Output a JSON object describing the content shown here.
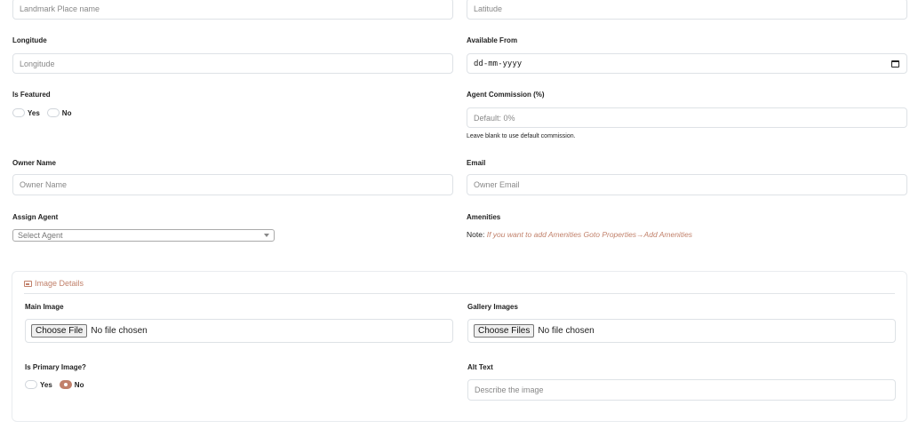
{
  "fields": {
    "landmark": {
      "placeholder": "Landmark Place name"
    },
    "latitude": {
      "placeholder": "Latitude"
    },
    "longitude": {
      "label": "Longitude",
      "placeholder": "Longitude"
    },
    "available_from": {
      "label": "Available From",
      "value": "dd-mm-yyyy",
      "icon": "calendar-icon"
    },
    "is_featured": {
      "label": "Is Featured",
      "options": [
        "Yes",
        "No"
      ],
      "selected": null
    },
    "agent_commission": {
      "label": "Agent Commission (%)",
      "placeholder": "Default: 0%",
      "help": "Leave blank to use default commission."
    },
    "owner_name": {
      "label": "Owner Name",
      "placeholder": "Owner Name"
    },
    "email": {
      "label": "Email",
      "placeholder": "Owner Email"
    },
    "assign_agent": {
      "label": "Assign Agent",
      "selected": "Select Agent"
    },
    "amenities": {
      "label": "Amenities",
      "note_prefix": "Note:",
      "note_text": "If you want to add Amenities Goto Properties→Add Amenities"
    }
  },
  "image_details": {
    "title": "Image Details",
    "icon": "image-icon",
    "main_image": {
      "label": "Main Image",
      "button": "Choose File",
      "status": "No file chosen"
    },
    "gallery_images": {
      "label": "Gallery Images",
      "button": "Choose Files",
      "status": "No file chosen"
    },
    "is_primary": {
      "label": "Is Primary Image?",
      "options": [
        "Yes",
        "No"
      ],
      "selected": "No"
    },
    "alt_text": {
      "label": "Alt Text",
      "placeholder": "Describe the image"
    }
  },
  "colors": {
    "accent": "#c1806a",
    "border": "#dee2e6"
  }
}
